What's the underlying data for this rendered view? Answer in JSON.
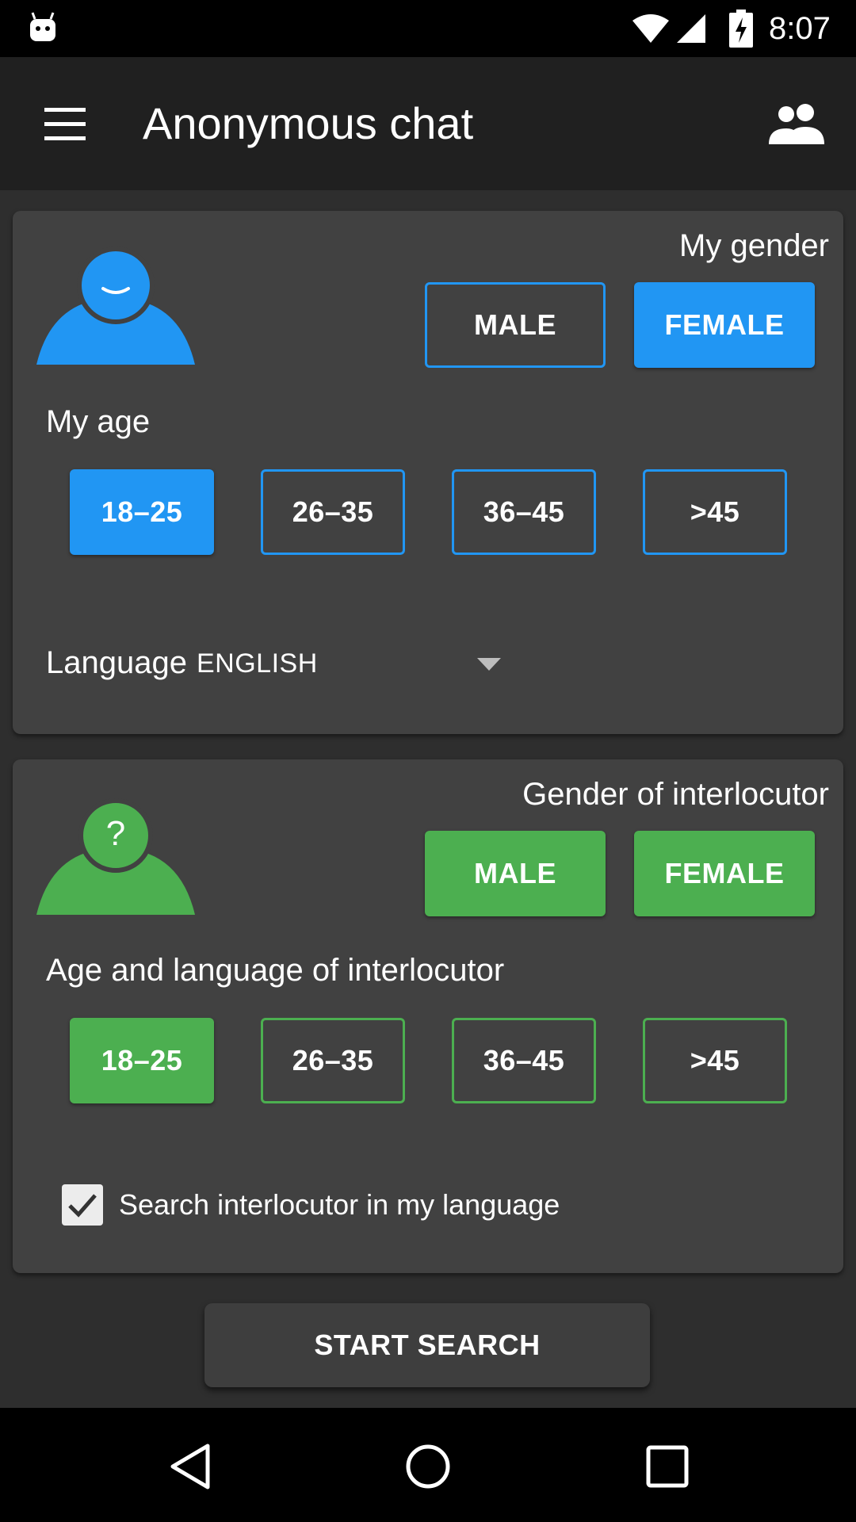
{
  "status_bar": {
    "time": "8:07",
    "icons": [
      "android-robot-icon",
      "wifi-icon",
      "cell-signal-icon",
      "battery-charging-icon"
    ]
  },
  "app_bar": {
    "title": "Anonymous chat",
    "menu_icon": "hamburger-menu-icon",
    "action_icon": "people-icon"
  },
  "my_profile": {
    "avatar_icon": "user-avatar-icon",
    "gender_label": "My gender",
    "gender_options": [
      "MALE",
      "FEMALE"
    ],
    "gender_selected": "FEMALE",
    "age_label": "My age",
    "age_options": [
      "18–25",
      "26–35",
      "36–45",
      ">45"
    ],
    "age_selected": "18–25",
    "language_label": "Language",
    "language_value": "ENGLISH"
  },
  "interlocutor": {
    "avatar_icon": "unknown-user-icon",
    "avatar_mark": "?",
    "gender_label": "Gender of interlocutor",
    "gender_options": [
      "MALE",
      "FEMALE"
    ],
    "gender_selected": [
      "MALE",
      "FEMALE"
    ],
    "age_label": "Age and language of interlocutor",
    "age_options": [
      "18–25",
      "26–35",
      "36–45",
      ">45"
    ],
    "age_selected": [
      "18–25"
    ],
    "same_language_checkbox_label": "Search interlocutor in my language",
    "same_language_checked": true
  },
  "actions": {
    "start_search": "START SEARCH"
  },
  "nav_bar": {
    "icons": [
      "back-icon",
      "home-icon",
      "recents-icon"
    ]
  },
  "colors": {
    "accent_blue": "#2196f3",
    "accent_green": "#4caf50",
    "card_background": "#414141",
    "app_bar_background": "#202020"
  }
}
